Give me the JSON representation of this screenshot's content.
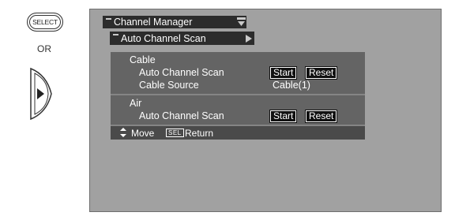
{
  "guide": {
    "select_key": "SELECT",
    "or_text": "OR",
    "right_key_icon": "right-arrow-icon"
  },
  "menu": {
    "title": "Channel Manager",
    "submenu": "Auto Channel Scan",
    "sections": [
      {
        "heading": "Cable",
        "rows": [
          {
            "label": "Auto Channel Scan",
            "buttons": [
              "Start",
              "Reset"
            ]
          },
          {
            "label": "Cable Source",
            "value": "Cable(1)"
          }
        ]
      },
      {
        "heading": "Air",
        "rows": [
          {
            "label": "Auto Channel Scan",
            "buttons": [
              "Start",
              "Reset"
            ]
          }
        ]
      }
    ],
    "footer": {
      "move": "Move",
      "sel_key": "SEL",
      "return": "Return"
    }
  },
  "colors": {
    "screen_bg": "#a1a1a1",
    "header_bg": "#2c2c2c",
    "panel_bg": "#646464"
  }
}
